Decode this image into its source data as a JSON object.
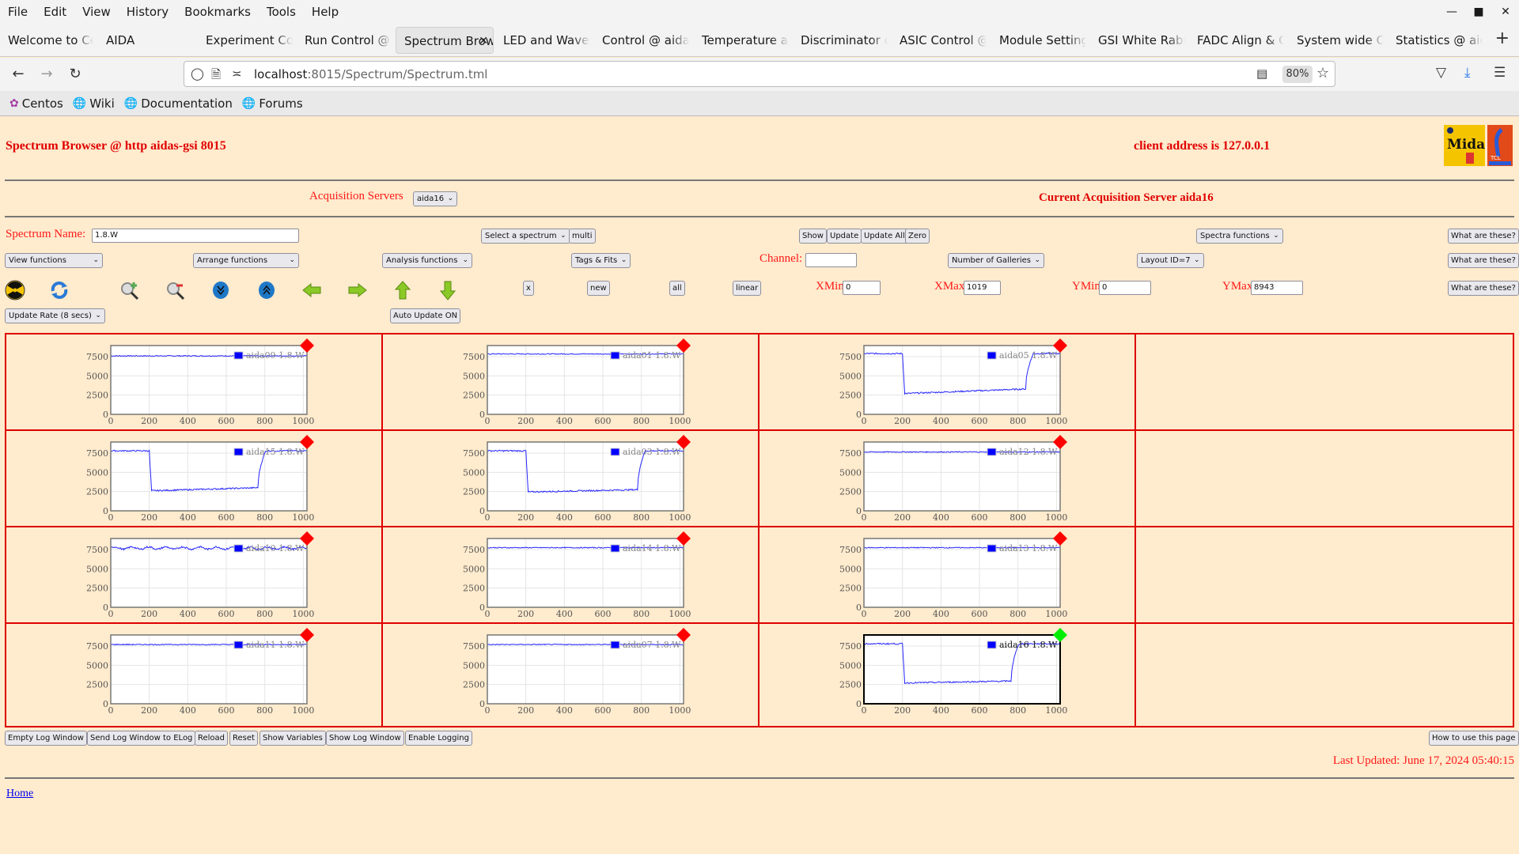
{
  "browser": {
    "menu": [
      "File",
      "Edit",
      "View",
      "History",
      "Bookmarks",
      "Tools",
      "Help"
    ],
    "tabs": [
      {
        "label": "Welcome to Centos",
        "active": false
      },
      {
        "label": "AIDA",
        "active": false
      },
      {
        "label": "Experiment Control",
        "active": false
      },
      {
        "label": "Run Control @ aidas",
        "active": false
      },
      {
        "label": "Spectrum Browser",
        "active": true
      },
      {
        "label": "LED and Waveform",
        "active": false
      },
      {
        "label": "Control @ aidas",
        "active": false
      },
      {
        "label": "Temperature and",
        "active": false
      },
      {
        "label": "Discriminator control",
        "active": false
      },
      {
        "label": "ASIC Control @",
        "active": false
      },
      {
        "label": "Module Settings",
        "active": false
      },
      {
        "label": "GSI White Rabbit",
        "active": false
      },
      {
        "label": "FADC Align & Control",
        "active": false
      },
      {
        "label": "System wide Checks",
        "active": false
      },
      {
        "label": "Statistics @ aidas",
        "active": false
      }
    ],
    "url_host": "localhost",
    "url_rest": ":8015/Spectrum/Spectrum.tml",
    "zoom": "80%",
    "bookmarks": [
      {
        "label": "Centos",
        "icon": "centos-icon"
      },
      {
        "label": "Wiki",
        "icon": "globe-icon"
      },
      {
        "label": "Documentation",
        "icon": "globe-icon"
      },
      {
        "label": "Forums",
        "icon": "globe-icon"
      }
    ]
  },
  "header": {
    "title": "Spectrum Browser @ http aidas-gsi 8015",
    "client_address": "client address is 127.0.0.1",
    "acquisition_label": "Acquisition Servers",
    "acquisition_selected": "aida16",
    "current_server": "Current Acquisition Server aida16"
  },
  "controls": {
    "spectrum_name_label": "Spectrum Name:",
    "spectrum_name_value": "1.8.W",
    "select_spectrum": "Select a spectrum",
    "multi": "multi",
    "show": "Show",
    "update": "Update",
    "update_all": "Update All",
    "zero": "Zero",
    "spectra_functions": "Spectra functions",
    "what_are_these": "What are these?",
    "view_functions": "View functions",
    "arrange_functions": "Arrange functions",
    "analysis_functions": "Analysis functions",
    "tags_fits": "Tags & Fits",
    "channel_label": "Channel:",
    "channel_value": "",
    "number_of_galleries": "Number of Galleries",
    "layout_id": "Layout ID=7",
    "x_btn": "x",
    "new_btn": "new",
    "all_btn": "all",
    "linear_btn": "linear",
    "xmin_label": "XMin",
    "xmin_value": "0",
    "xmax_label": "XMax",
    "xmax_value": "1019",
    "ymin_label": "YMin",
    "ymin_value": "0",
    "ymax_label": "YMax",
    "ymax_value": "8943",
    "update_rate": "Update Rate (8 secs)",
    "auto_update": "Auto Update ON",
    "toolbar_icons": [
      "radiation-icon",
      "refresh-icon",
      "zoom-in-icon",
      "zoom-out-icon",
      "scroll-down-icon",
      "scroll-up-icon",
      "arrow-left-icon",
      "arrow-right-icon",
      "arrow-up-icon",
      "arrow-down-icon"
    ]
  },
  "footer": {
    "buttons": [
      "Empty Log Window",
      "Send Log Window to ELog",
      "Reload",
      "Reset",
      "Show Variables",
      "Show Log Window",
      "Enable Logging"
    ],
    "help_button": "How to use this page",
    "last_updated": "Last Updated: June 17, 2024 05:40:15",
    "home_link": "Home"
  },
  "colors": {
    "page_bg": "#ffebcd",
    "accent_red": "#ff1a1a",
    "series_blue": "#0000ff",
    "status_bad": "#ff0000",
    "status_ok": "#00ee00"
  },
  "chart_data": [
    {
      "type": "line",
      "title": "aida09 1.8.W",
      "legend": "aida09 1.8.W",
      "status": "red",
      "selected": false,
      "shape": "flat",
      "level": 7600,
      "xlim": [
        0,
        1019
      ],
      "ylim": [
        0,
        8943
      ],
      "xticks": [
        0,
        200,
        400,
        600,
        800,
        1000
      ],
      "yticks": [
        0,
        2500,
        5000,
        7500
      ]
    },
    {
      "type": "line",
      "title": "aida01 1.8.W",
      "legend": "aida01 1.8.W",
      "status": "red",
      "selected": false,
      "shape": "flat",
      "level": 7850,
      "xlim": [
        0,
        1019
      ],
      "ylim": [
        0,
        8943
      ],
      "xticks": [
        0,
        200,
        400,
        600,
        800,
        1000
      ],
      "yticks": [
        0,
        2500,
        5000,
        7500
      ]
    },
    {
      "type": "line",
      "title": "aida05 1.8.W",
      "legend": "aida05 1.8.W",
      "status": "red",
      "selected": false,
      "shape": "dip",
      "level": 7900,
      "dip_start": 200,
      "dip_end": 840,
      "dip_low": 2700,
      "dip_high": 3300,
      "xlim": [
        0,
        1019
      ],
      "ylim": [
        0,
        8943
      ],
      "xticks": [
        0,
        200,
        400,
        600,
        800,
        1000
      ],
      "yticks": [
        0,
        2500,
        5000,
        7500
      ]
    },
    {
      "type": "line",
      "title": "aida15 1.8.W",
      "legend": "aida15 1.8.W",
      "status": "red",
      "selected": false,
      "shape": "dip",
      "level": 7800,
      "dip_start": 200,
      "dip_end": 765,
      "dip_low": 2600,
      "dip_high": 3000,
      "xlim": [
        0,
        1019
      ],
      "ylim": [
        0,
        8943
      ],
      "xticks": [
        0,
        200,
        400,
        600,
        800,
        1000
      ],
      "yticks": [
        0,
        2500,
        5000,
        7500
      ]
    },
    {
      "type": "line",
      "title": "aida03 1.8.W",
      "legend": "aida03 1.8.W",
      "status": "red",
      "selected": false,
      "shape": "dip",
      "level": 7800,
      "dip_start": 200,
      "dip_end": 780,
      "dip_low": 2450,
      "dip_high": 2750,
      "xlim": [
        0,
        1019
      ],
      "ylim": [
        0,
        8943
      ],
      "xticks": [
        0,
        200,
        400,
        600,
        800,
        1000
      ],
      "yticks": [
        0,
        2500,
        5000,
        7500
      ]
    },
    {
      "type": "line",
      "title": "aida12 1.8.W",
      "legend": "aida12 1.8.W",
      "status": "red",
      "selected": false,
      "shape": "flat",
      "level": 7650,
      "xlim": [
        0,
        1019
      ],
      "ylim": [
        0,
        8943
      ],
      "xticks": [
        0,
        200,
        400,
        600,
        800,
        1000
      ],
      "yticks": [
        0,
        2500,
        5000,
        7500
      ]
    },
    {
      "type": "line",
      "title": "aida10 1.8.W",
      "legend": "aida10 1.8.W",
      "status": "red",
      "selected": false,
      "shape": "wavy",
      "level": 7700,
      "xlim": [
        0,
        1019
      ],
      "ylim": [
        0,
        8943
      ],
      "xticks": [
        0,
        200,
        400,
        600,
        800,
        1000
      ],
      "yticks": [
        0,
        2500,
        5000,
        7500
      ]
    },
    {
      "type": "line",
      "title": "aida14 1.8.W",
      "legend": "aida14 1.8.W",
      "status": "red",
      "selected": false,
      "shape": "flat",
      "level": 7750,
      "xlim": [
        0,
        1019
      ],
      "ylim": [
        0,
        8943
      ],
      "xticks": [
        0,
        200,
        400,
        600,
        800,
        1000
      ],
      "yticks": [
        0,
        2500,
        5000,
        7500
      ]
    },
    {
      "type": "line",
      "title": "aida13 1.8.W",
      "legend": "aida13 1.8.W",
      "status": "red",
      "selected": false,
      "shape": "flat",
      "level": 7750,
      "xlim": [
        0,
        1019
      ],
      "ylim": [
        0,
        8943
      ],
      "xticks": [
        0,
        200,
        400,
        600,
        800,
        1000
      ],
      "yticks": [
        0,
        2500,
        5000,
        7500
      ]
    },
    {
      "type": "line",
      "title": "aida11 1.8.W",
      "legend": "aida11 1.8.W",
      "status": "red",
      "selected": false,
      "shape": "flat",
      "level": 7700,
      "xlim": [
        0,
        1019
      ],
      "ylim": [
        0,
        8943
      ],
      "xticks": [
        0,
        200,
        400,
        600,
        800,
        1000
      ],
      "yticks": [
        0,
        2500,
        5000,
        7500
      ]
    },
    {
      "type": "line",
      "title": "aida07 1.8.W",
      "legend": "aida07 1.8.W",
      "status": "red",
      "selected": false,
      "shape": "flat",
      "level": 7700,
      "xlim": [
        0,
        1019
      ],
      "ylim": [
        0,
        8943
      ],
      "xticks": [
        0,
        200,
        400,
        600,
        800,
        1000
      ],
      "yticks": [
        0,
        2500,
        5000,
        7500
      ]
    },
    {
      "type": "line",
      "title": "aida16 1.8.W",
      "legend": "aida16 1.8.W",
      "status": "green",
      "selected": true,
      "shape": "dip",
      "level": 7800,
      "dip_start": 200,
      "dip_end": 765,
      "dip_low": 2700,
      "dip_high": 2950,
      "xlim": [
        0,
        1019
      ],
      "ylim": [
        0,
        8943
      ],
      "xticks": [
        0,
        200,
        400,
        600,
        800,
        1000
      ],
      "yticks": [
        0,
        2500,
        5000,
        7500
      ]
    }
  ]
}
